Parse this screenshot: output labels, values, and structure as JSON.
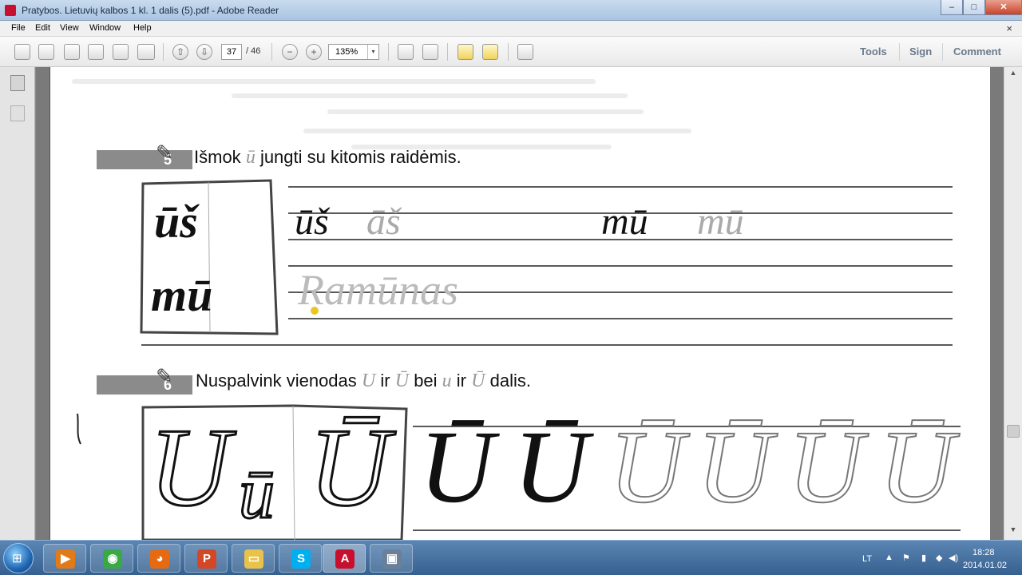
{
  "window": {
    "title": "Pratybos. Lietuvių kalbos 1 kl. 1 dalis (5).pdf - Adobe Reader",
    "minimize": "–",
    "maximize": "□",
    "close": "✕"
  },
  "menu": {
    "items": [
      "File",
      "Edit",
      "View",
      "Window",
      "Help"
    ],
    "doc_close": "×"
  },
  "toolbar": {
    "icons": [
      "create-pdf-icon",
      "open-icon",
      "edit-icon",
      "folder-icon",
      "print-icon",
      "email-icon",
      "previous-page-icon",
      "next-page-icon",
      "zoom-out-icon",
      "zoom-in-icon",
      "fit-page-icon",
      "fit-width-icon",
      "comment-icon",
      "highlight-icon",
      "fullscreen-icon"
    ],
    "page_current": "37",
    "page_total": "/ 46",
    "zoom_value": "135%",
    "zoom_arrow": "▾",
    "prev_glyph": "⇧",
    "next_glyph": "⇩",
    "zoom_out_glyph": "−",
    "zoom_in_glyph": "+",
    "links": {
      "tools": "Tools",
      "sign": "Sign",
      "comment": "Comment"
    }
  },
  "navpane": {
    "icons": [
      "page-thumbnails-icon",
      "attachments-icon"
    ]
  },
  "document": {
    "exercise5": {
      "number": "5",
      "text_before": "Išmok",
      "script_letter": "ū",
      "text_after": "jungti su kitomis raidėmis.",
      "card_words": [
        "ūš",
        "mū"
      ],
      "line1_words": [
        "ūš",
        "āš",
        "mū",
        "mū"
      ],
      "line2_word": "Ramūnas"
    },
    "exercise6": {
      "number": "6",
      "part1": "Nuspalvink vienodas",
      "script1": "U",
      "part2": "ir",
      "script2": "Ū",
      "part3": "bei",
      "script3": "u",
      "part4": "ir",
      "script4": "Ū",
      "part5": "dalis.",
      "card_letters": [
        "U",
        "ū",
        "Ū"
      ],
      "practice_letters": [
        "Ū",
        "Ū",
        "Ū",
        "Ū",
        "Ū",
        "Ū"
      ]
    }
  },
  "taskbar": {
    "start_glyph": "⊞",
    "apps": [
      {
        "name": "media-player",
        "glyph": "▶",
        "color": "#e07b1a"
      },
      {
        "name": "chrome",
        "glyph": "◉",
        "color": "#3aa845"
      },
      {
        "name": "firefox",
        "glyph": "◕",
        "color": "#e66a12"
      },
      {
        "name": "powerpoint",
        "glyph": "P",
        "color": "#d24726"
      },
      {
        "name": "explorer",
        "glyph": "▭",
        "color": "#e8c24a"
      },
      {
        "name": "skype",
        "glyph": "S",
        "color": "#00aff0"
      },
      {
        "name": "adobe-reader",
        "glyph": "A",
        "color": "#c8102e"
      },
      {
        "name": "save-app",
        "glyph": "▣",
        "color": "#6b7f99"
      }
    ],
    "language": "LT",
    "tray_arrow": "▲",
    "tray_flag": "⚑",
    "tray_battery": "▮",
    "tray_network": "◆",
    "tray_volume": "◀)",
    "time": "18:28",
    "date": "2014.01.02"
  }
}
